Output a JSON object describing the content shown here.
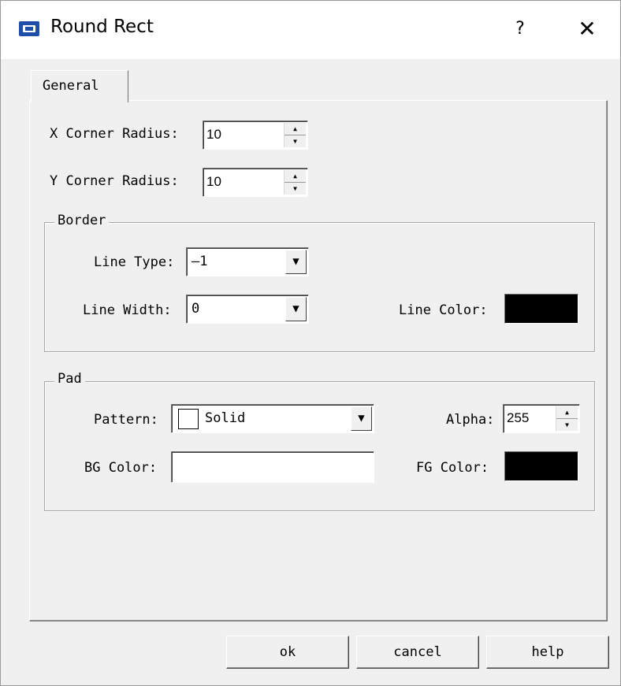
{
  "window": {
    "title": "Round Rect",
    "help_glyph": "?",
    "close_glyph": "✕",
    "icon": "app-icon"
  },
  "tabs": [
    {
      "label": "General",
      "selected": true
    }
  ],
  "general": {
    "x_radius": {
      "label": "X Corner Radius:",
      "value": "10"
    },
    "y_radius": {
      "label": "Y Corner Radius:",
      "value": "10"
    }
  },
  "border": {
    "title": "Border",
    "line_type": {
      "label": "Line Type:",
      "value": "—1"
    },
    "line_width": {
      "label": "Line Width:",
      "value": "0"
    },
    "line_color": {
      "label": "Line Color:",
      "color": "#000000"
    }
  },
  "pad": {
    "title": "Pad",
    "pattern": {
      "label": "Pattern:",
      "value": "Solid"
    },
    "alpha": {
      "label": "Alpha:",
      "value": "255"
    },
    "bg_color": {
      "label": "BG Color:",
      "color": "#ffffff"
    },
    "fg_color": {
      "label": "FG Color:",
      "color": "#000000"
    }
  },
  "buttons": {
    "ok": "ok",
    "cancel": "cancel",
    "help": "help"
  },
  "glyphs": {
    "spin_up": "▲",
    "spin_down": "▼",
    "dropdown": "▼"
  }
}
